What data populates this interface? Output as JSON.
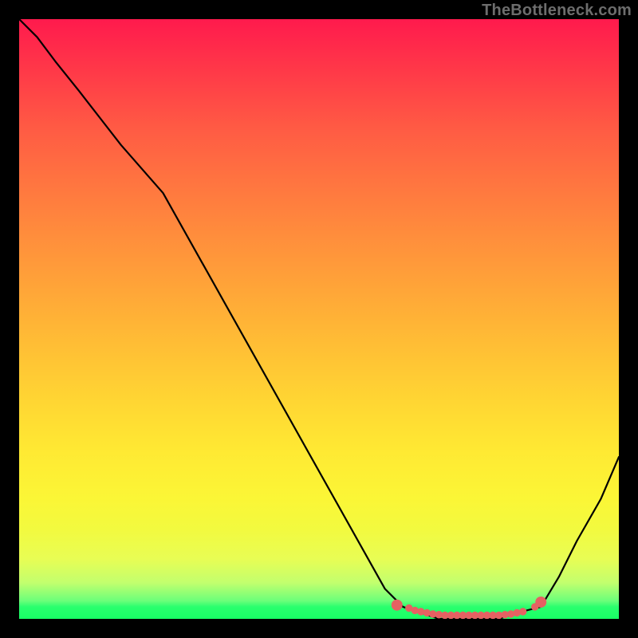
{
  "watermark": "TheBottleneck.com",
  "colors": {
    "curve_stroke": "#000000",
    "marker_stroke": "#e56162",
    "marker_fill": "#e56162"
  },
  "chart_data": {
    "type": "line",
    "title": "",
    "xlabel": "",
    "ylabel": "",
    "x": [
      0.0,
      0.03,
      0.06,
      0.1,
      0.17,
      0.24,
      0.61,
      0.64,
      0.67,
      0.7,
      0.73,
      0.76,
      0.8,
      0.83,
      0.87,
      0.9,
      0.93,
      0.97,
      1.0
    ],
    "values": [
      1.0,
      0.97,
      0.93,
      0.88,
      0.79,
      0.71,
      0.05,
      0.02,
      0.01,
      0.0,
      0.0,
      0.0,
      0.0,
      0.01,
      0.02,
      0.07,
      0.13,
      0.2,
      0.27
    ],
    "xlim": [
      0,
      1
    ],
    "ylim": [
      0,
      1
    ],
    "markers_x": [
      0.63,
      0.65,
      0.66,
      0.67,
      0.68,
      0.69,
      0.7,
      0.71,
      0.72,
      0.73,
      0.74,
      0.75,
      0.76,
      0.77,
      0.78,
      0.79,
      0.8,
      0.81,
      0.82,
      0.83,
      0.84,
      0.86,
      0.87
    ],
    "markers_y": [
      0.023,
      0.018,
      0.014,
      0.012,
      0.01,
      0.008,
      0.007,
      0.006,
      0.006,
      0.006,
      0.006,
      0.006,
      0.006,
      0.006,
      0.006,
      0.006,
      0.006,
      0.007,
      0.008,
      0.01,
      0.012,
      0.02,
      0.028
    ]
  }
}
